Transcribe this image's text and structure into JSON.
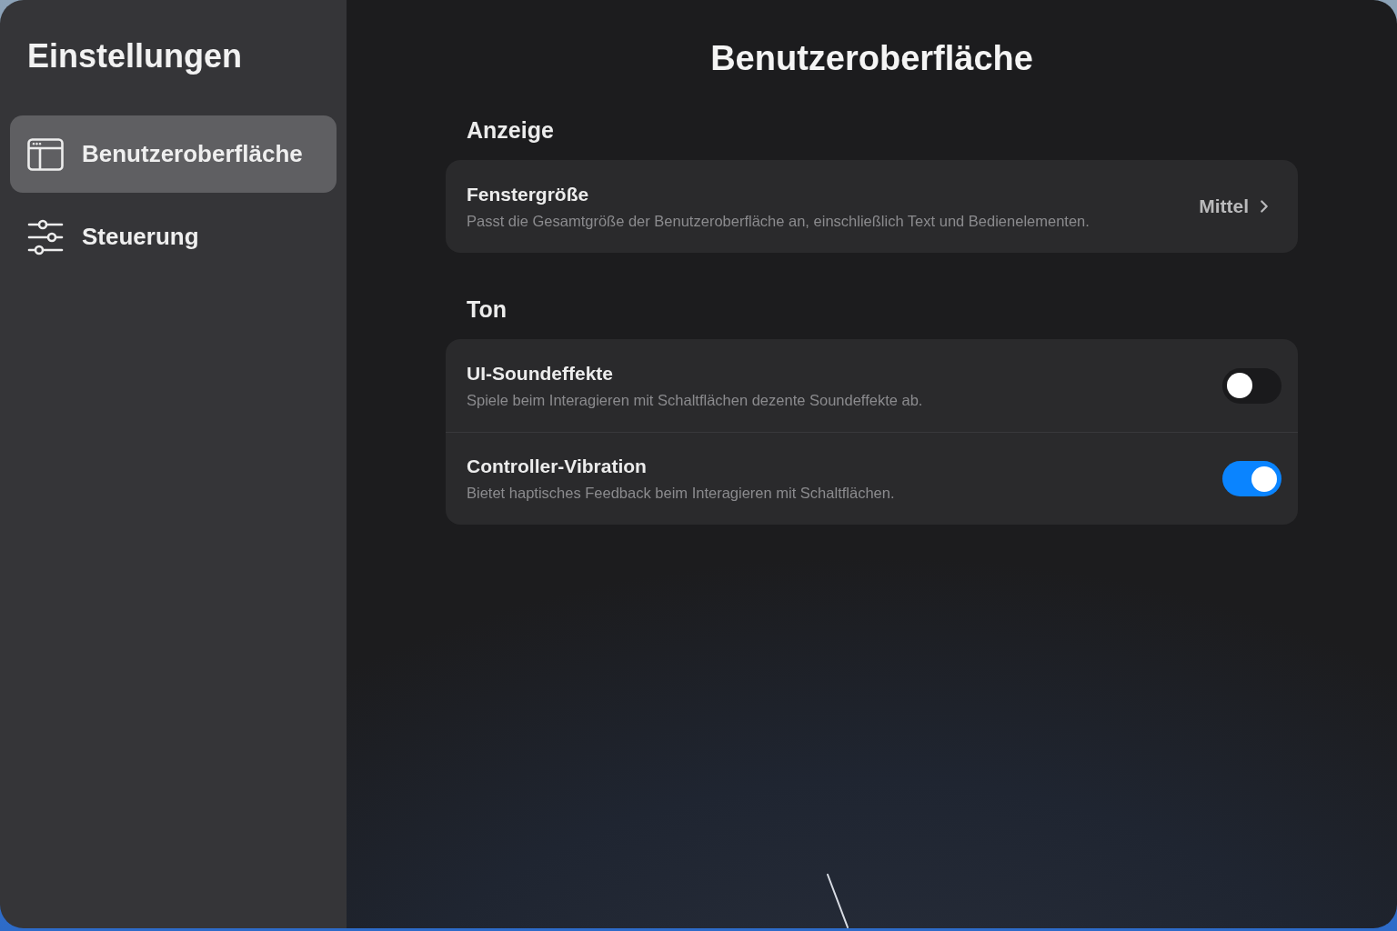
{
  "sidebar": {
    "title": "Einstellungen",
    "items": [
      {
        "label": "Benutzeroberfläche",
        "selected": true
      },
      {
        "label": "Steuerung",
        "selected": false
      }
    ]
  },
  "page": {
    "title": "Benutzeroberfläche"
  },
  "sections": [
    {
      "title": "Anzeige",
      "rows": [
        {
          "kind": "value",
          "title": "Fenstergröße",
          "description": "Passt die Gesamtgröße der Benutzeroberfläche an, einschließlich Text und Bedienelementen.",
          "value": "Mittel"
        }
      ]
    },
    {
      "title": "Ton",
      "rows": [
        {
          "kind": "toggle",
          "title": "UI-Soundeffekte",
          "description": "Spiele beim Interagieren mit Schaltflächen dezente Soundeffekte ab.",
          "on": false
        },
        {
          "kind": "toggle",
          "title": "Controller-Vibration",
          "description": "Bietet haptisches Feedback beim Interagieren mit Schaltflächen.",
          "on": true
        }
      ]
    }
  ]
}
